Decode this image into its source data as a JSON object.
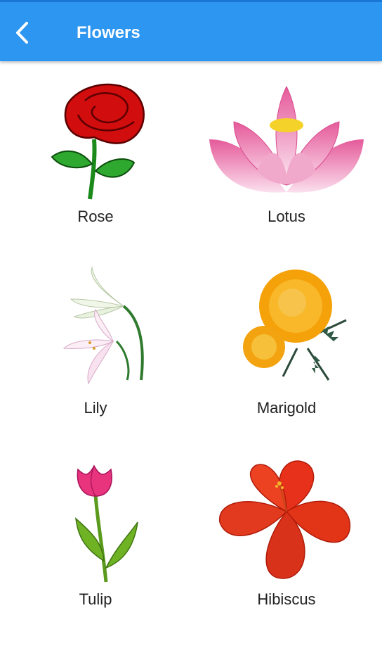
{
  "appbar": {
    "title": "Flowers",
    "back_icon": "arrow-back-icon",
    "color": "#2D96F0"
  },
  "flowers": [
    {
      "name": "Rose"
    },
    {
      "name": "Lotus"
    },
    {
      "name": "Lily"
    },
    {
      "name": "Marigold"
    },
    {
      "name": "Tulip"
    },
    {
      "name": "Hibiscus"
    }
  ]
}
